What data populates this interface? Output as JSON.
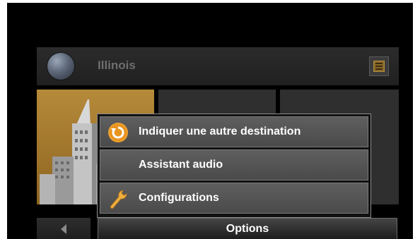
{
  "header": {
    "region_name": "Illinois"
  },
  "popup_menu": {
    "items": [
      {
        "label": "Indiquer une autre destination",
        "icon": "reroute-icon"
      },
      {
        "label": "Assistant audio",
        "icon": ""
      },
      {
        "label": "Configurations",
        "icon": "wrench-icon"
      }
    ]
  },
  "bottom_bar": {
    "options_label": "Options"
  },
  "colors": {
    "accent": "#e8941f",
    "menu_item": "#555555",
    "tile_city": "#a87a30"
  }
}
